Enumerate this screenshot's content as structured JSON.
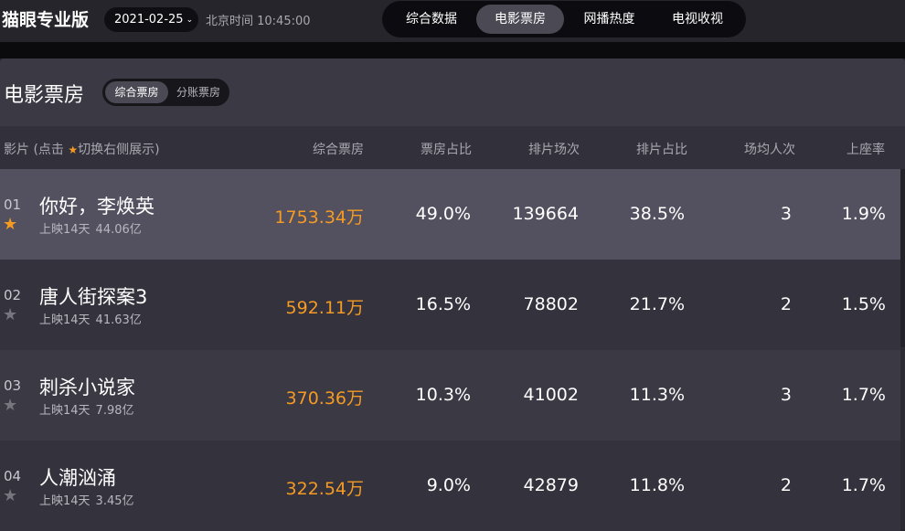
{
  "brand": "猫眼专业版",
  "date": "2021-02-25",
  "clock": "北京时间 10:45:00",
  "nav_tabs": [
    {
      "label": "综合数据",
      "active": false
    },
    {
      "label": "电影票房",
      "active": true
    },
    {
      "label": "网播热度",
      "active": false
    },
    {
      "label": "电视收视",
      "active": false
    }
  ],
  "panel": {
    "title": "电影票房",
    "segments": [
      {
        "label": "综合票房",
        "active": true
      },
      {
        "label": "分账票房",
        "active": false
      }
    ]
  },
  "table": {
    "movie_header_before": "影片 (点击",
    "movie_header_after": "切换右侧展示)",
    "headers": [
      "综合票房",
      "票房占比",
      "排片场次",
      "排片占比",
      "场均人次",
      "上座率"
    ],
    "rows": [
      {
        "rank": "01",
        "starred": true,
        "name": "你好，李焕英",
        "days": "上映14天",
        "total": "44.06亿",
        "box_office": "1753.34万",
        "box_share": "49.0%",
        "shows": "139664",
        "show_share": "38.5%",
        "avg_per_show": "3",
        "occupancy": "1.9%"
      },
      {
        "rank": "02",
        "starred": false,
        "name": "唐人街探案3",
        "days": "上映14天",
        "total": "41.63亿",
        "box_office": "592.11万",
        "box_share": "16.5%",
        "shows": "78802",
        "show_share": "21.7%",
        "avg_per_show": "2",
        "occupancy": "1.5%"
      },
      {
        "rank": "03",
        "starred": false,
        "name": "刺杀小说家",
        "days": "上映14天",
        "total": "7.98亿",
        "box_office": "370.36万",
        "box_share": "10.3%",
        "shows": "41002",
        "show_share": "11.3%",
        "avg_per_show": "3",
        "occupancy": "1.7%"
      },
      {
        "rank": "04",
        "starred": false,
        "name": "人潮汹涌",
        "days": "上映14天",
        "total": "3.45亿",
        "box_office": "322.54万",
        "box_share": "9.0%",
        "shows": "42879",
        "show_share": "11.8%",
        "avg_per_show": "2",
        "occupancy": "1.7%"
      }
    ]
  },
  "colors": {
    "accent_orange": "#f59a23",
    "star_inactive": "#77767e",
    "row_selected": "#53515f",
    "row_odd": "#3a3944",
    "row_even": "#34333d"
  }
}
